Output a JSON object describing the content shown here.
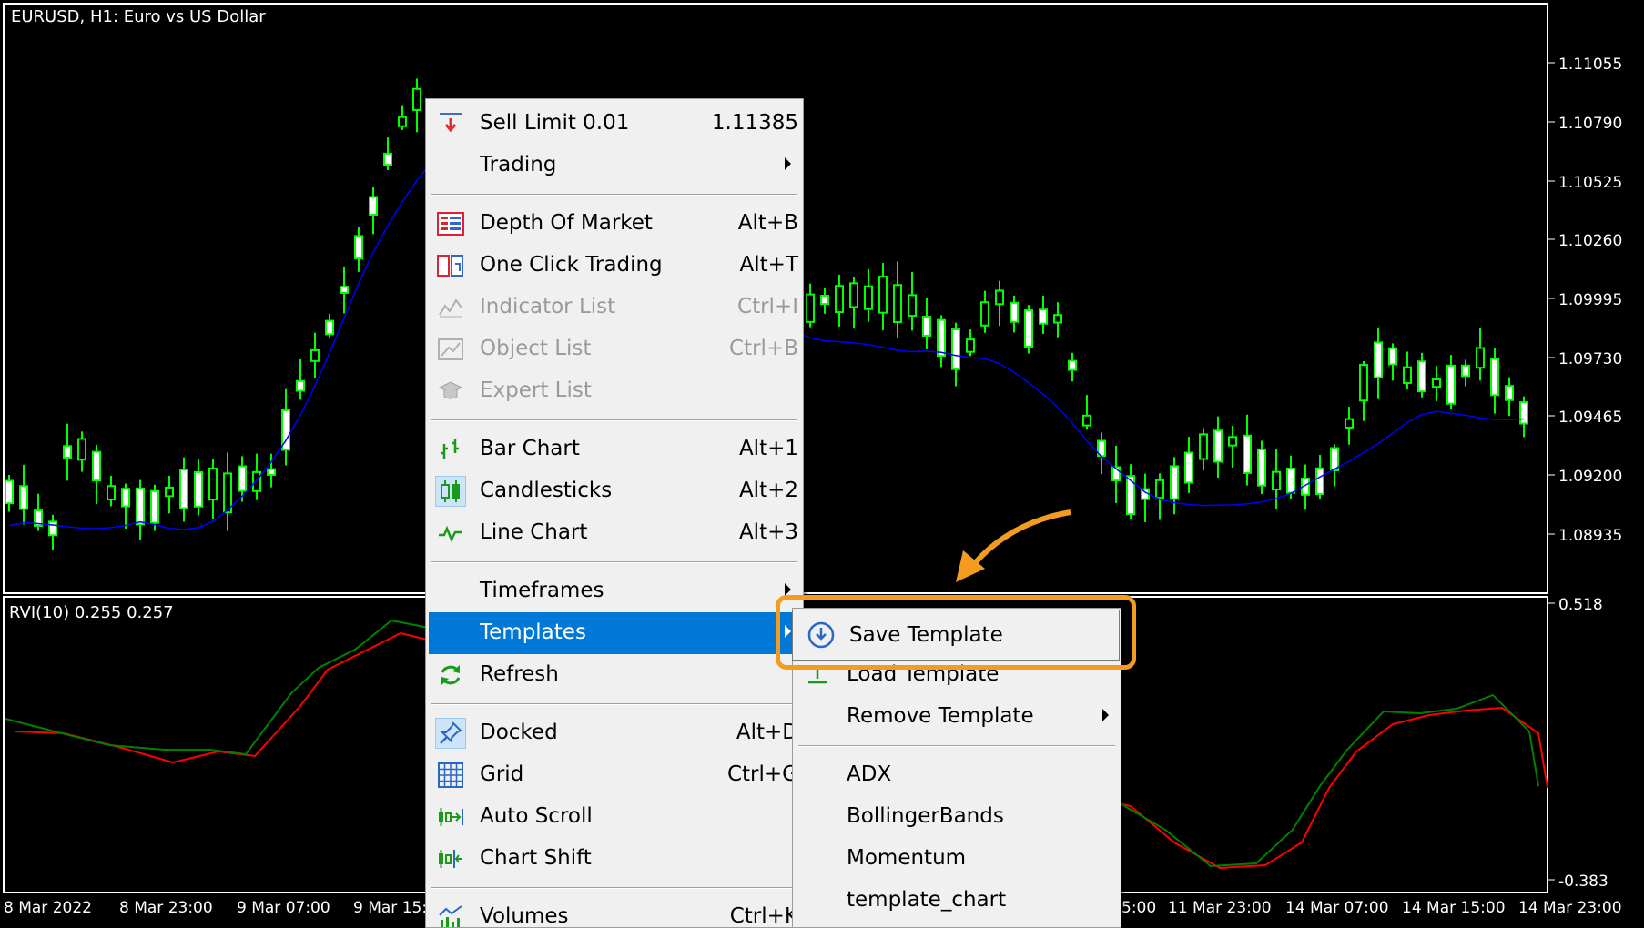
{
  "chart": {
    "title": "EURUSD, H1:  Euro vs US Dollar",
    "indicator_label": "RVI(10) 0.255 0.257",
    "price_ticks": [
      "1.11055",
      "1.10790",
      "1.10525",
      "1.10260",
      "1.09995",
      "1.09730",
      "1.09465",
      "1.09200",
      "1.08935"
    ],
    "indicator_ticks": [
      "0.518",
      "-0.383"
    ],
    "time_ticks": [
      "8 Mar 2022",
      "8 Mar 23:00",
      "9 Mar 07:00",
      "9 Mar 15:",
      "5:00",
      "11 Mar 23:00",
      "14 Mar 07:00",
      "14 Mar 15:00",
      "14 Mar 23:00"
    ],
    "colors": {
      "bull_candle": "#00ff00",
      "ma_line": "#0000ff",
      "rvi_main": "#008000",
      "rvi_signal": "#ff0000",
      "menu_selected": "#0078d7",
      "highlight": "#f39c1f"
    }
  },
  "context_menu": {
    "items": [
      {
        "label": "Sell Limit 0.01",
        "shortcut": "1.11385",
        "icon": "sell-limit-icon"
      },
      {
        "label": "Trading",
        "submenu": true
      },
      {
        "label": "Depth Of Market",
        "shortcut": "Alt+B",
        "icon": "depth-of-market-icon"
      },
      {
        "label": "One Click Trading",
        "shortcut": "Alt+T",
        "icon": "one-click-trading-icon"
      },
      {
        "label": "Indicator List",
        "shortcut": "Ctrl+I",
        "icon": "indicator-list-icon",
        "disabled": true
      },
      {
        "label": "Object List",
        "shortcut": "Ctrl+B",
        "icon": "object-list-icon",
        "disabled": true
      },
      {
        "label": "Expert List",
        "icon": "expert-list-icon",
        "disabled": true
      },
      {
        "label": "Bar Chart",
        "shortcut": "Alt+1",
        "icon": "bar-chart-icon"
      },
      {
        "label": "Candlesticks",
        "shortcut": "Alt+2",
        "icon": "candlesticks-icon"
      },
      {
        "label": "Line Chart",
        "shortcut": "Alt+3",
        "icon": "line-chart-icon"
      },
      {
        "label": "Timeframes",
        "submenu": true
      },
      {
        "label": "Templates",
        "submenu": true,
        "selected": true
      },
      {
        "label": "Refresh",
        "icon": "refresh-icon"
      },
      {
        "label": "Docked",
        "shortcut": "Alt+D",
        "icon": "pin-icon"
      },
      {
        "label": "Grid",
        "shortcut": "Ctrl+G",
        "icon": "grid-icon"
      },
      {
        "label": "Auto Scroll",
        "icon": "auto-scroll-icon"
      },
      {
        "label": "Chart Shift",
        "icon": "chart-shift-icon"
      },
      {
        "label": "Volumes",
        "shortcut": "Ctrl+K",
        "icon": "volumes-icon"
      }
    ]
  },
  "templates_menu": {
    "items": [
      {
        "label": "Save Template",
        "icon": "save-template-icon"
      },
      {
        "label": "Load Template",
        "icon": "load-template-icon"
      },
      {
        "label": "Remove Template",
        "submenu": true
      },
      {
        "label": "ADX"
      },
      {
        "label": "BollingerBands"
      },
      {
        "label": "Momentum"
      },
      {
        "label": "template_chart"
      }
    ]
  }
}
